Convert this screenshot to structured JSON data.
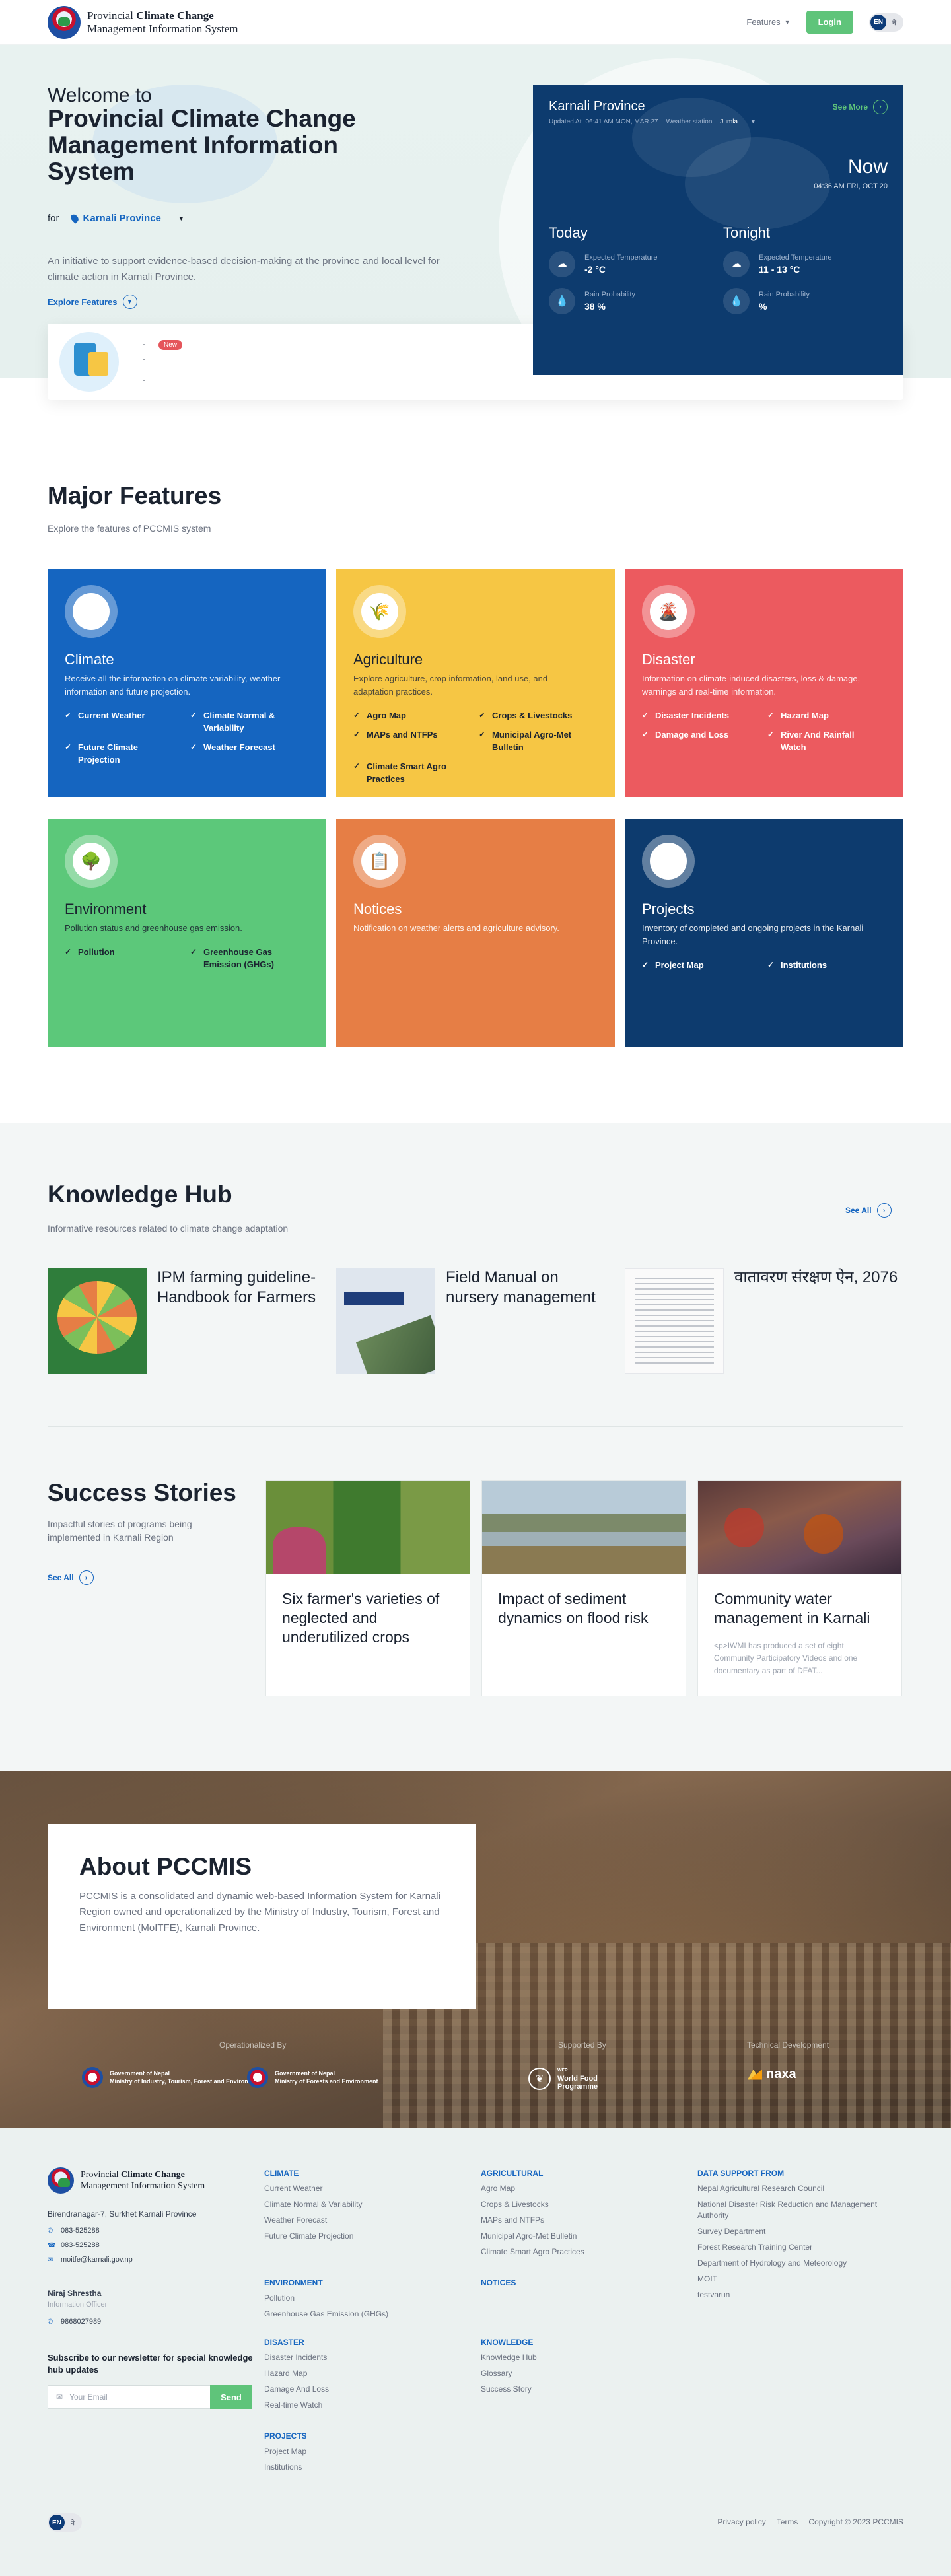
{
  "header": {
    "logo_line1_prefix": "Provincial ",
    "logo_line1_bold": "Climate Change",
    "logo_line2": "Management Information System",
    "features_label": "Features",
    "login_label": "Login",
    "lang_active": "EN",
    "lang_inactive": "ने"
  },
  "hero": {
    "welcome": "Welcome to",
    "title": "Provincial Climate Change Management Information System",
    "for_label": "for",
    "province": "Karnali Province",
    "description": "An initiative to support evidence-based decision-making at the province and local level for climate action in Karnali Province.",
    "explore_label": "Explore Features",
    "notice": {
      "badge": "New",
      "line1": "-",
      "line2": "-",
      "line3": "-"
    }
  },
  "weather": {
    "province": "Karnali Province",
    "see_more": "See More",
    "updated_label": "Updated At",
    "updated_value": "06:41 AM MON, MAR 27",
    "station_label": "Weather station",
    "station_value": "Jumla",
    "now_label": "Now",
    "now_datetime": "04:36 AM FRI, OCT 20",
    "today": {
      "label": "Today",
      "temp_label": "Expected Temperature",
      "temp_value": "-2 °C",
      "rain_label": "Rain Probability",
      "rain_value": "38 %"
    },
    "tonight": {
      "label": "Tonight",
      "temp_label": "Expected Temperature",
      "temp_value": "11 - 13 °C",
      "rain_label": "Rain Probability",
      "rain_value": "%"
    }
  },
  "features": {
    "title": "Major Features",
    "subtitle": "Explore the features of PCCMIS system",
    "items": [
      {
        "name": "Climate",
        "color": "#1565c0",
        "desc": "Receive all the information on climate variability, weather information and future projection.",
        "links": [
          "Current Weather",
          "Climate Normal & Variability",
          "Future Climate Projection",
          "Weather Forecast"
        ]
      },
      {
        "name": "Agriculture",
        "color": "#f6c644",
        "desc": "Explore agriculture, crop information, land use, and adaptation practices.",
        "links": [
          "Agro Map",
          "Crops & Livestocks",
          "MAPs and NTFPs",
          "Municipal Agro-Met Bulletin",
          "Climate Smart Agro Practices"
        ]
      },
      {
        "name": "Disaster",
        "color": "#ec5a5f",
        "desc": "Information on climate-induced disasters, loss & damage, warnings and real-time information.",
        "links": [
          "Disaster Incidents",
          "Hazard Map",
          "Damage and Loss",
          "River And Rainfall Watch"
        ]
      },
      {
        "name": "Environment",
        "color": "#5cc87a",
        "desc": "Pollution status and greenhouse gas emission.",
        "links": [
          "Pollution",
          "Greenhouse Gas Emission (GHGs)"
        ]
      },
      {
        "name": "Notices",
        "color": "#e67e45",
        "desc": "Notification on weather alerts and agriculture advisory.",
        "links": []
      },
      {
        "name": "Projects",
        "color": "#0d3b6e",
        "desc": "Inventory of completed and ongoing projects in the Karnali Province.",
        "links": [
          "Project Map",
          "Institutions"
        ]
      }
    ]
  },
  "knowledge_hub": {
    "title": "Knowledge Hub",
    "subtitle": "Informative resources related to climate change adaptation",
    "see_all": "See All",
    "items": [
      {
        "title": "IPM farming guideline-Handbook for Farmers"
      },
      {
        "title": "Field Manual on nursery management"
      },
      {
        "title": "वातावरण संरक्षण ऐन, 2076"
      }
    ]
  },
  "success_stories": {
    "title": "Success Stories",
    "subtitle": "Impactful stories of programs being implemented in Karnali Region",
    "see_all": "See All",
    "items": [
      {
        "title": "Six farmer's varieties of neglected and underutilized crops",
        "body": ""
      },
      {
        "title": "Impact of sediment dynamics on flood risk",
        "body": ""
      },
      {
        "title": "Community water management in Karnali",
        "body": "<p>IWMI has produced a set of eight Community Participatory Videos and one documentary as part of DFAT..."
      }
    ]
  },
  "about": {
    "title": "About PCCMIS",
    "body": "PCCMIS is a consolidated and dynamic web-based Information System for Karnali Region owned and operationalized by the Ministry of Industry, Tourism, Forest and Environment (MoITFE), Karnali Province.",
    "operationalized_by": "Operationalized By",
    "supported_by": "Supported By",
    "technical_dev": "Technical Development",
    "partner1_line1": "Government of Nepal",
    "partner1_line2": "Ministry of Industry, Tourism, Forest and Environment",
    "partner2_line1": "Government of Nepal",
    "partner2_line2": "Ministry of Forests and Environment",
    "partner3_line1": "World Food",
    "partner3_line2": "Programme",
    "partner3_top": "WFP",
    "partner4": "naxa"
  },
  "footer": {
    "address": "Birendranagar-7, Surkhet Karnali Province",
    "phone1": "083-525288",
    "phone2": "083-525288",
    "email": "moitfe@karnali.gov.np",
    "contact_name": "Niraj Shrestha",
    "contact_role": "Information Officer",
    "contact_phone": "9868027989",
    "newsletter_text": "Subscribe to our newsletter for special knowledge hub updates",
    "newsletter_placeholder": "Your Email",
    "newsletter_button": "Send",
    "columns": {
      "climate": {
        "title": "CLIMATE",
        "links": [
          "Current Weather",
          "Climate Normal & Variability",
          "Weather Forecast",
          "Future Climate Projection"
        ]
      },
      "environment": {
        "title": "ENVIRONMENT",
        "links": [
          "Pollution",
          "Greenhouse Gas Emission (GHGs)"
        ]
      },
      "disaster": {
        "title": "DISASTER",
        "links": [
          "Disaster Incidents",
          "Hazard Map",
          "Damage And Loss",
          "Real-time Watch"
        ]
      },
      "projects": {
        "title": "PROJECTS",
        "links": [
          "Project Map",
          "Institutions"
        ]
      },
      "agricultural": {
        "title": "AGRICULTURAL",
        "links": [
          "Agro Map",
          "Crops & Livestocks",
          "MAPs and NTFPs",
          "Municipal Agro-Met Bulletin",
          "Climate Smart Agro Practices"
        ]
      },
      "notices": {
        "title": "NOTICES",
        "links": []
      },
      "knowledge": {
        "title": "KNOWLEDGE",
        "links": [
          "Knowledge Hub",
          "Glossary",
          "Success Story"
        ]
      },
      "data_support": {
        "title": "DATA SUPPORT FROM",
        "links": [
          "Nepal Agricultural Research Council",
          "National Disaster Risk Reduction and Management Authority",
          "Survey Department",
          "Forest Research Training Center",
          "Department of Hydrology and Meteorology",
          "MOIT",
          "testvarun"
        ]
      }
    },
    "privacy": "Privacy policy",
    "terms": "Terms",
    "copyright": "Copyright © 2023 PCCMIS"
  }
}
